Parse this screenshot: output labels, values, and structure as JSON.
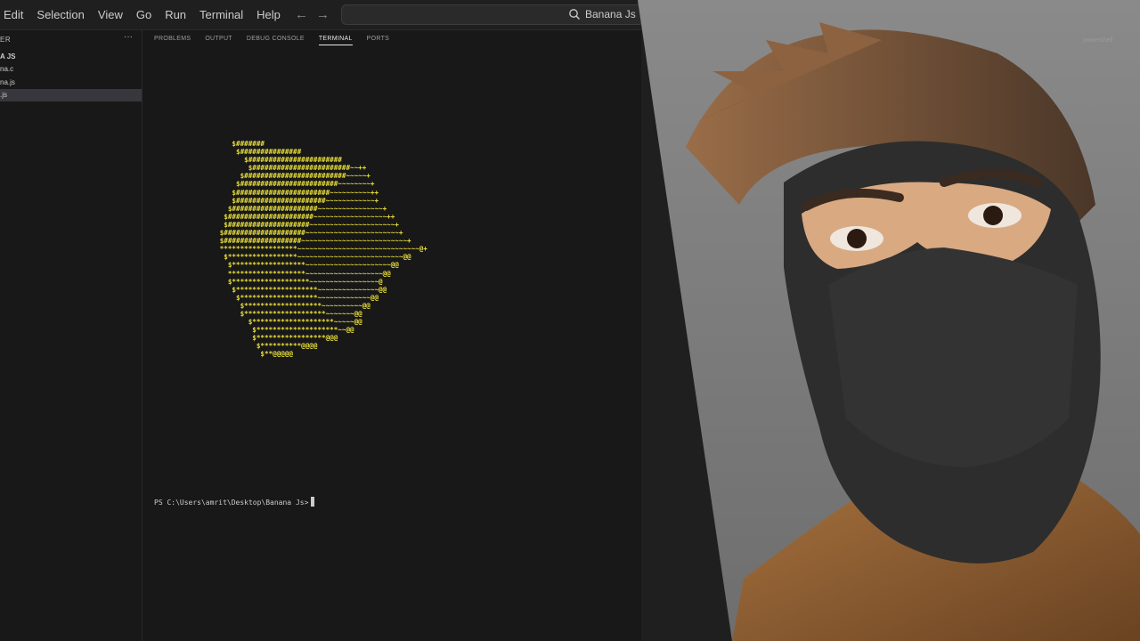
{
  "menu": [
    "Edit",
    "Selection",
    "View",
    "Go",
    "Run",
    "Terminal",
    "Help"
  ],
  "command_center": {
    "title": "Banana Js"
  },
  "sidebar": {
    "header": "ER",
    "more": "···",
    "folder": "A JS",
    "files": [
      "na.c",
      "na.js",
      ".js"
    ]
  },
  "panel": {
    "tabs": [
      "PROBLEMS",
      "OUTPUT",
      "DEBUG CONSOLE",
      "TERMINAL",
      "PORTS"
    ],
    "active_tab": "TERMINAL",
    "shell_label": "powershell"
  },
  "terminal": {
    "ascii_art": "      $#######\n       $###############\n         $#######################\n          $########################~~++\n        $#########################~~~~~+\n       $########################~~~~~~~~+\n      $#######################~~~~~~~~~~++\n      $######################~~~~~~~~~~~~+\n     $#####################~~~~~~~~~~~~~~~~+\n    $#####################~~~~~~~~~~~~~~~~~~++\n    $####################~~~~~~~~~~~~~~~~~~~~~+\n   $####################~~~~~~~~~~~~~~~~~~~~~~~+\n   $###################~~~~~~~~~~~~~~~~~~~~~~~~~~+\n   *******************~~~~~~~~~~~~~~~~~~~~~~~~~~~~~~@+\n    $*****************~~~~~~~~~~~~~~~~~~~~~~~~~~@@\n     $******************~~~~~~~~~~~~~~~~~~~~~@@\n     *******************~~~~~~~~~~~~~~~~~~~@@\n     $*******************~~~~~~~~~~~~~~~~~@\n      $********************~~~~~~~~~~~~~~~@@\n       $*******************~~~~~~~~~~~~~@@\n        $*******************~~~~~~~~~~@@\n        $********************~~~~~~~@@\n          $********************~~~~~@@\n           $********************~~@@\n           $*****************@@@\n            $**********@@@@\n             $**@@@@@",
    "prompt": "PS C:\\Users\\amrit\\Desktop\\Banana Js>"
  },
  "colors": {
    "ascii": "#e8de3a",
    "editor_bg": "#181818",
    "titlebar_bg": "#1f1f1f"
  },
  "icons": [
    "arrow-left-icon",
    "arrow-right-icon",
    "search-icon",
    "layout-icon",
    "toggle-sidebar-icon",
    "toggle-panel-icon",
    "toggle-secondary-sidebar-icon"
  ]
}
